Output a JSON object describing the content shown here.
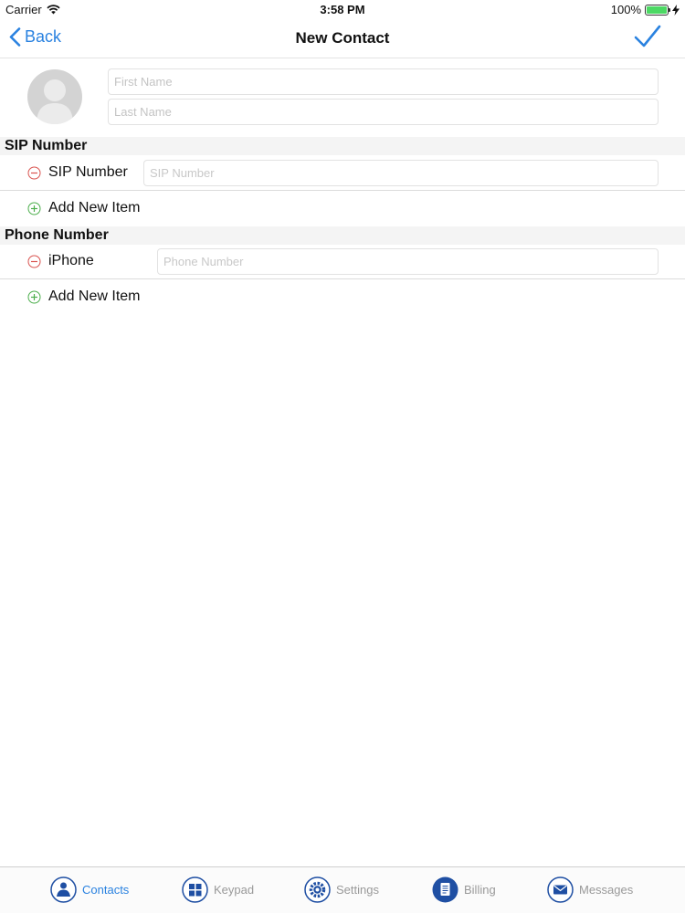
{
  "status": {
    "carrier": "Carrier",
    "time": "3:58 PM",
    "battery": "100%"
  },
  "nav": {
    "back_label": "Back",
    "title": "New Contact"
  },
  "name": {
    "first_placeholder": "First Name",
    "last_placeholder": "Last Name"
  },
  "sip": {
    "header": "SIP Number",
    "item_label": "SIP Number",
    "item_placeholder": "SIP Number",
    "add_label": "Add New Item"
  },
  "phone": {
    "header": "Phone Number",
    "item_label": "iPhone",
    "item_placeholder": "Phone Number",
    "add_label": "Add New Item"
  },
  "tabs": [
    {
      "label": "Contacts",
      "icon": "contacts-icon",
      "active": true
    },
    {
      "label": "Keypad",
      "icon": "keypad-icon",
      "active": false
    },
    {
      "label": "Settings",
      "icon": "settings-icon",
      "active": false
    },
    {
      "label": "Billing",
      "icon": "billing-icon",
      "active": false
    },
    {
      "label": "Messages",
      "icon": "messages-icon",
      "active": false
    }
  ],
  "colors": {
    "accent": "#2a82e0",
    "remove": "#d9534f",
    "add": "#4cae4c",
    "tab_icon": "#1f4fa3"
  }
}
